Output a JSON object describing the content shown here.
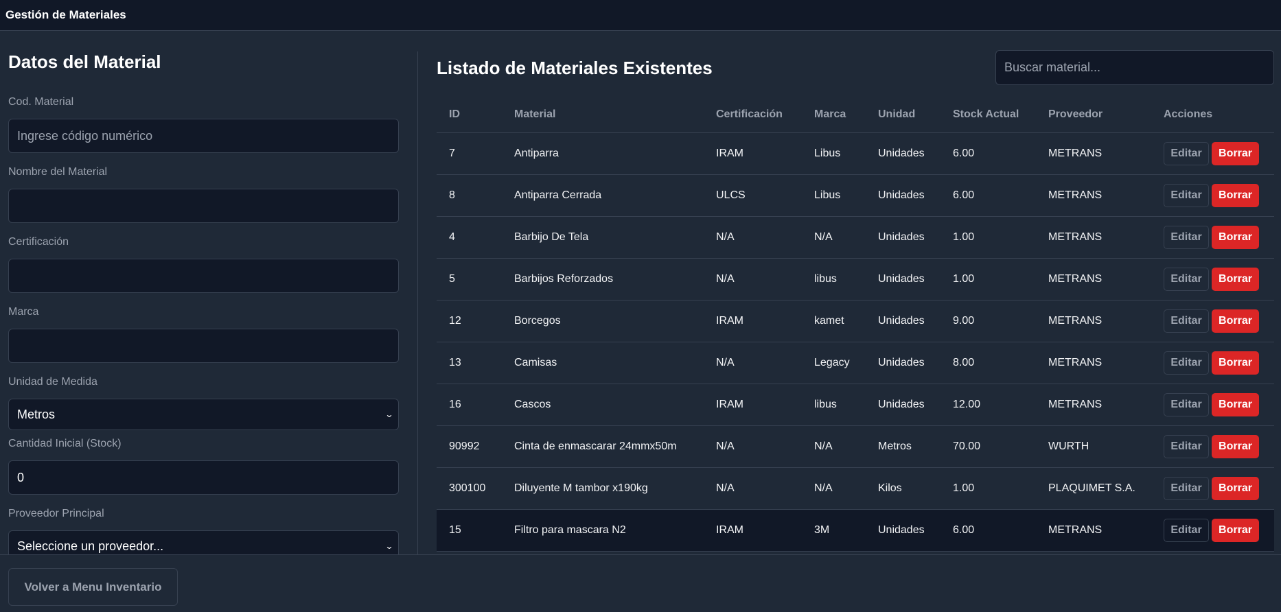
{
  "header": {
    "title": "Gestión de Materiales"
  },
  "form": {
    "title": "Datos del Material",
    "fields": [
      {
        "label": "Cod. Material",
        "value": "",
        "placeholder": "Ingrese código numérico"
      },
      {
        "label": "Nombre del Material",
        "value": ""
      },
      {
        "label": "Certificación",
        "value": ""
      },
      {
        "label": "Marca",
        "value": ""
      },
      {
        "label": "Unidad de Medida",
        "value": "Metros"
      },
      {
        "label": "Cantidad Inicial (Stock)",
        "value": "0"
      },
      {
        "label": "Proveedor Principal",
        "value": "Seleccione un proveedor..."
      }
    ]
  },
  "list": {
    "title": "Listado de Materiales Existentes",
    "search_placeholder": "Buscar material...",
    "columns": [
      "ID",
      "Material",
      "Certificación",
      "Marca",
      "Unidad",
      "Stock Actual",
      "Proveedor",
      "Acciones"
    ],
    "edit_label": "Editar",
    "delete_label": "Borrar",
    "rows": [
      [
        "7",
        "Antiparra",
        "IRAM",
        "Libus",
        "Unidades",
        "6.00",
        "METRANS"
      ],
      [
        "8",
        "Antiparra Cerrada",
        "ULCS",
        "Libus",
        "Unidades",
        "6.00",
        "METRANS"
      ],
      [
        "4",
        "Barbijo De Tela",
        "N/A",
        "N/A",
        "Unidades",
        "1.00",
        "METRANS"
      ],
      [
        "5",
        "Barbijos Reforzados",
        "N/A",
        "libus",
        "Unidades",
        "1.00",
        "METRANS"
      ],
      [
        "12",
        "Borcegos",
        "IRAM",
        "kamet",
        "Unidades",
        "9.00",
        "METRANS"
      ],
      [
        "13",
        "Camisas",
        "N/A",
        "Legacy",
        "Unidades",
        "8.00",
        "METRANS"
      ],
      [
        "16",
        "Cascos",
        "IRAM",
        "libus",
        "Unidades",
        "12.00",
        "METRANS"
      ],
      [
        "90992",
        "Cinta de enmascarar 24mmx50m",
        "N/A",
        "N/A",
        "Metros",
        "70.00",
        "WURTH"
      ],
      [
        "300100",
        "Diluyente M tambor x190kg",
        "N/A",
        "N/A",
        "Kilos",
        "1.00",
        "PLAQUIMET S.A."
      ],
      [
        "15",
        "Filtro para mascara N2",
        "IRAM",
        "3M",
        "Unidades",
        "6.00",
        "METRANS"
      ]
    ]
  },
  "footer": {
    "back_label": "Volver a Menu Inventario"
  }
}
